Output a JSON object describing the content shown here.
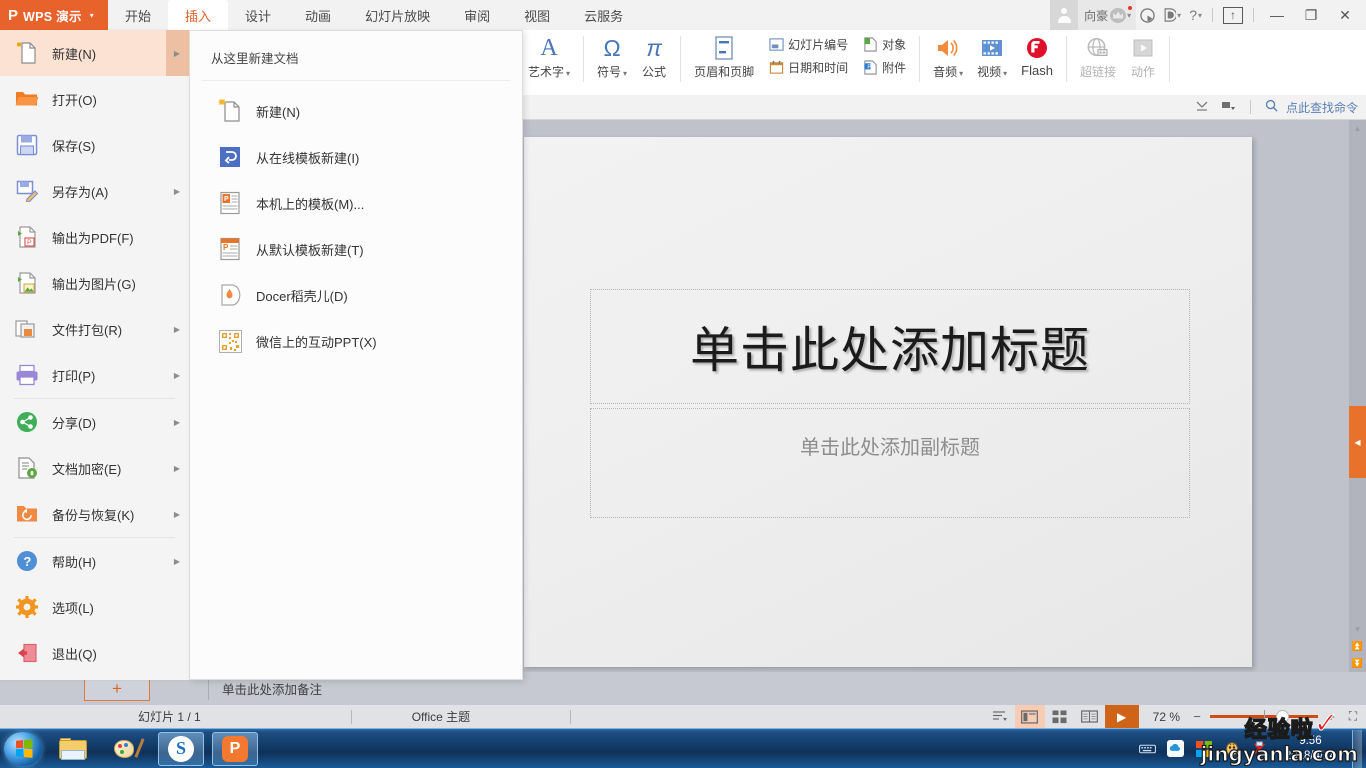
{
  "titlebar": {
    "logo_mark": "P",
    "logo_text": "WPS 演示",
    "logo_caret": "▾",
    "tabs": [
      {
        "label": "开始",
        "active": false
      },
      {
        "label": "插入",
        "active": true
      },
      {
        "label": "设计",
        "active": false
      },
      {
        "label": "动画",
        "active": false
      },
      {
        "label": "幻灯片放映",
        "active": false
      },
      {
        "label": "审阅",
        "active": false
      },
      {
        "label": "视图",
        "active": false
      },
      {
        "label": "云服务",
        "active": false
      }
    ],
    "username": "向豪",
    "minimize": "—",
    "restore": "❐",
    "close": "✕",
    "help_label": "?",
    "caret": "▾"
  },
  "ribbon": {
    "wordart": {
      "label": "艺术字",
      "glyph": "A",
      "caret": "▾"
    },
    "symbol": {
      "label": "符号",
      "glyph": "Ω",
      "caret": "▾"
    },
    "formula": {
      "label": "公式",
      "glyph": "π"
    },
    "header_footer": {
      "label": "页眉和页脚"
    },
    "slide_number": {
      "label": "幻灯片编号"
    },
    "date_time": {
      "label": "日期和时间"
    },
    "object": {
      "label": "对象"
    },
    "attachment": {
      "label": "附件"
    },
    "audio": {
      "label": "音频",
      "caret": "▾"
    },
    "video": {
      "label": "视频",
      "caret": "▾"
    },
    "flash": {
      "label": "Flash"
    },
    "hyperlink": {
      "label": "超链接"
    },
    "action": {
      "label": "动作"
    }
  },
  "search": {
    "placeholder": "点此查找命令",
    "label": "点此查找命令"
  },
  "filemenu": {
    "items": [
      {
        "label": "新建(N)",
        "icon": "new-doc-icon",
        "arrow": true,
        "selected": true,
        "sep_after": false
      },
      {
        "label": "打开(O)",
        "icon": "open-folder-icon",
        "arrow": false,
        "selected": false,
        "sep_after": false
      },
      {
        "label": "保存(S)",
        "icon": "save-disk-icon",
        "arrow": false,
        "selected": false,
        "sep_after": false
      },
      {
        "label": "另存为(A)",
        "icon": "save-as-icon",
        "arrow": true,
        "selected": false,
        "sep_after": false
      },
      {
        "label": "输出为PDF(F)",
        "icon": "export-pdf-icon",
        "arrow": false,
        "selected": false,
        "sep_after": false
      },
      {
        "label": "输出为图片(G)",
        "icon": "export-image-icon",
        "arrow": false,
        "selected": false,
        "sep_after": false
      },
      {
        "label": "文件打包(R)",
        "icon": "package-icon",
        "arrow": true,
        "selected": false,
        "sep_after": false
      },
      {
        "label": "打印(P)",
        "icon": "printer-icon",
        "arrow": true,
        "selected": false,
        "sep_after": true
      },
      {
        "label": "分享(D)",
        "icon": "share-icon",
        "arrow": true,
        "selected": false,
        "sep_after": false
      },
      {
        "label": "文档加密(E)",
        "icon": "document-lock-icon",
        "arrow": true,
        "selected": false,
        "sep_after": false
      },
      {
        "label": "备份与恢复(K)",
        "icon": "backup-restore-icon",
        "arrow": true,
        "selected": false,
        "sep_after": true
      },
      {
        "label": "帮助(H)",
        "icon": "help-circle-icon",
        "arrow": true,
        "selected": false,
        "sep_after": false
      },
      {
        "label": "选项(L)",
        "icon": "gear-icon",
        "arrow": false,
        "selected": false,
        "sep_after": false
      },
      {
        "label": "退出(Q)",
        "icon": "exit-icon",
        "arrow": false,
        "selected": false,
        "sep_after": false
      }
    ]
  },
  "flyout": {
    "title": "从这里新建文档",
    "items": [
      {
        "label": "新建(N)",
        "icon": "new-page-sparkle-icon"
      },
      {
        "label": "从在线模板新建(I)",
        "icon": "online-template-icon"
      },
      {
        "label": "本机上的模板(M)...",
        "icon": "local-template-icon"
      },
      {
        "label": "从默认模板新建(T)",
        "icon": "default-template-icon"
      },
      {
        "label": "Docer稻壳儿(D)",
        "icon": "docer-icon"
      },
      {
        "label": "微信上的互动PPT(X)",
        "icon": "qrcode-icon"
      }
    ]
  },
  "slide": {
    "title_placeholder": "单击此处添加标题",
    "subtitle_placeholder": "单击此处添加副标题"
  },
  "notes": {
    "add_slide_label": "+",
    "placeholder": "单击此处添加备注"
  },
  "statusbar": {
    "slide_count": "幻灯片 1 / 1",
    "theme": "Office 主题",
    "zoom_value": "72 %",
    "zoom_minus": "−",
    "zoom_plus": "+",
    "views": [
      {
        "name": "outline-view",
        "selected": false
      },
      {
        "name": "normal-view",
        "selected": true
      },
      {
        "name": "slide-sorter-view",
        "selected": false
      },
      {
        "name": "reading-view",
        "selected": false
      }
    ],
    "play_label": "▶",
    "fit_label": "⛶"
  },
  "taskbar": {
    "start_label": "开始",
    "apps": [
      {
        "name": "file-explorer",
        "active": false
      },
      {
        "name": "paint",
        "active": false
      },
      {
        "name": "sogou-browser",
        "active": true
      },
      {
        "name": "wps-presentation",
        "active": true
      }
    ],
    "clock_time": "9:56",
    "clock_date": "2018/4/14"
  },
  "watermark": {
    "line1": "经验啦",
    "line2": "jingyanla.com",
    "check": "✓"
  }
}
